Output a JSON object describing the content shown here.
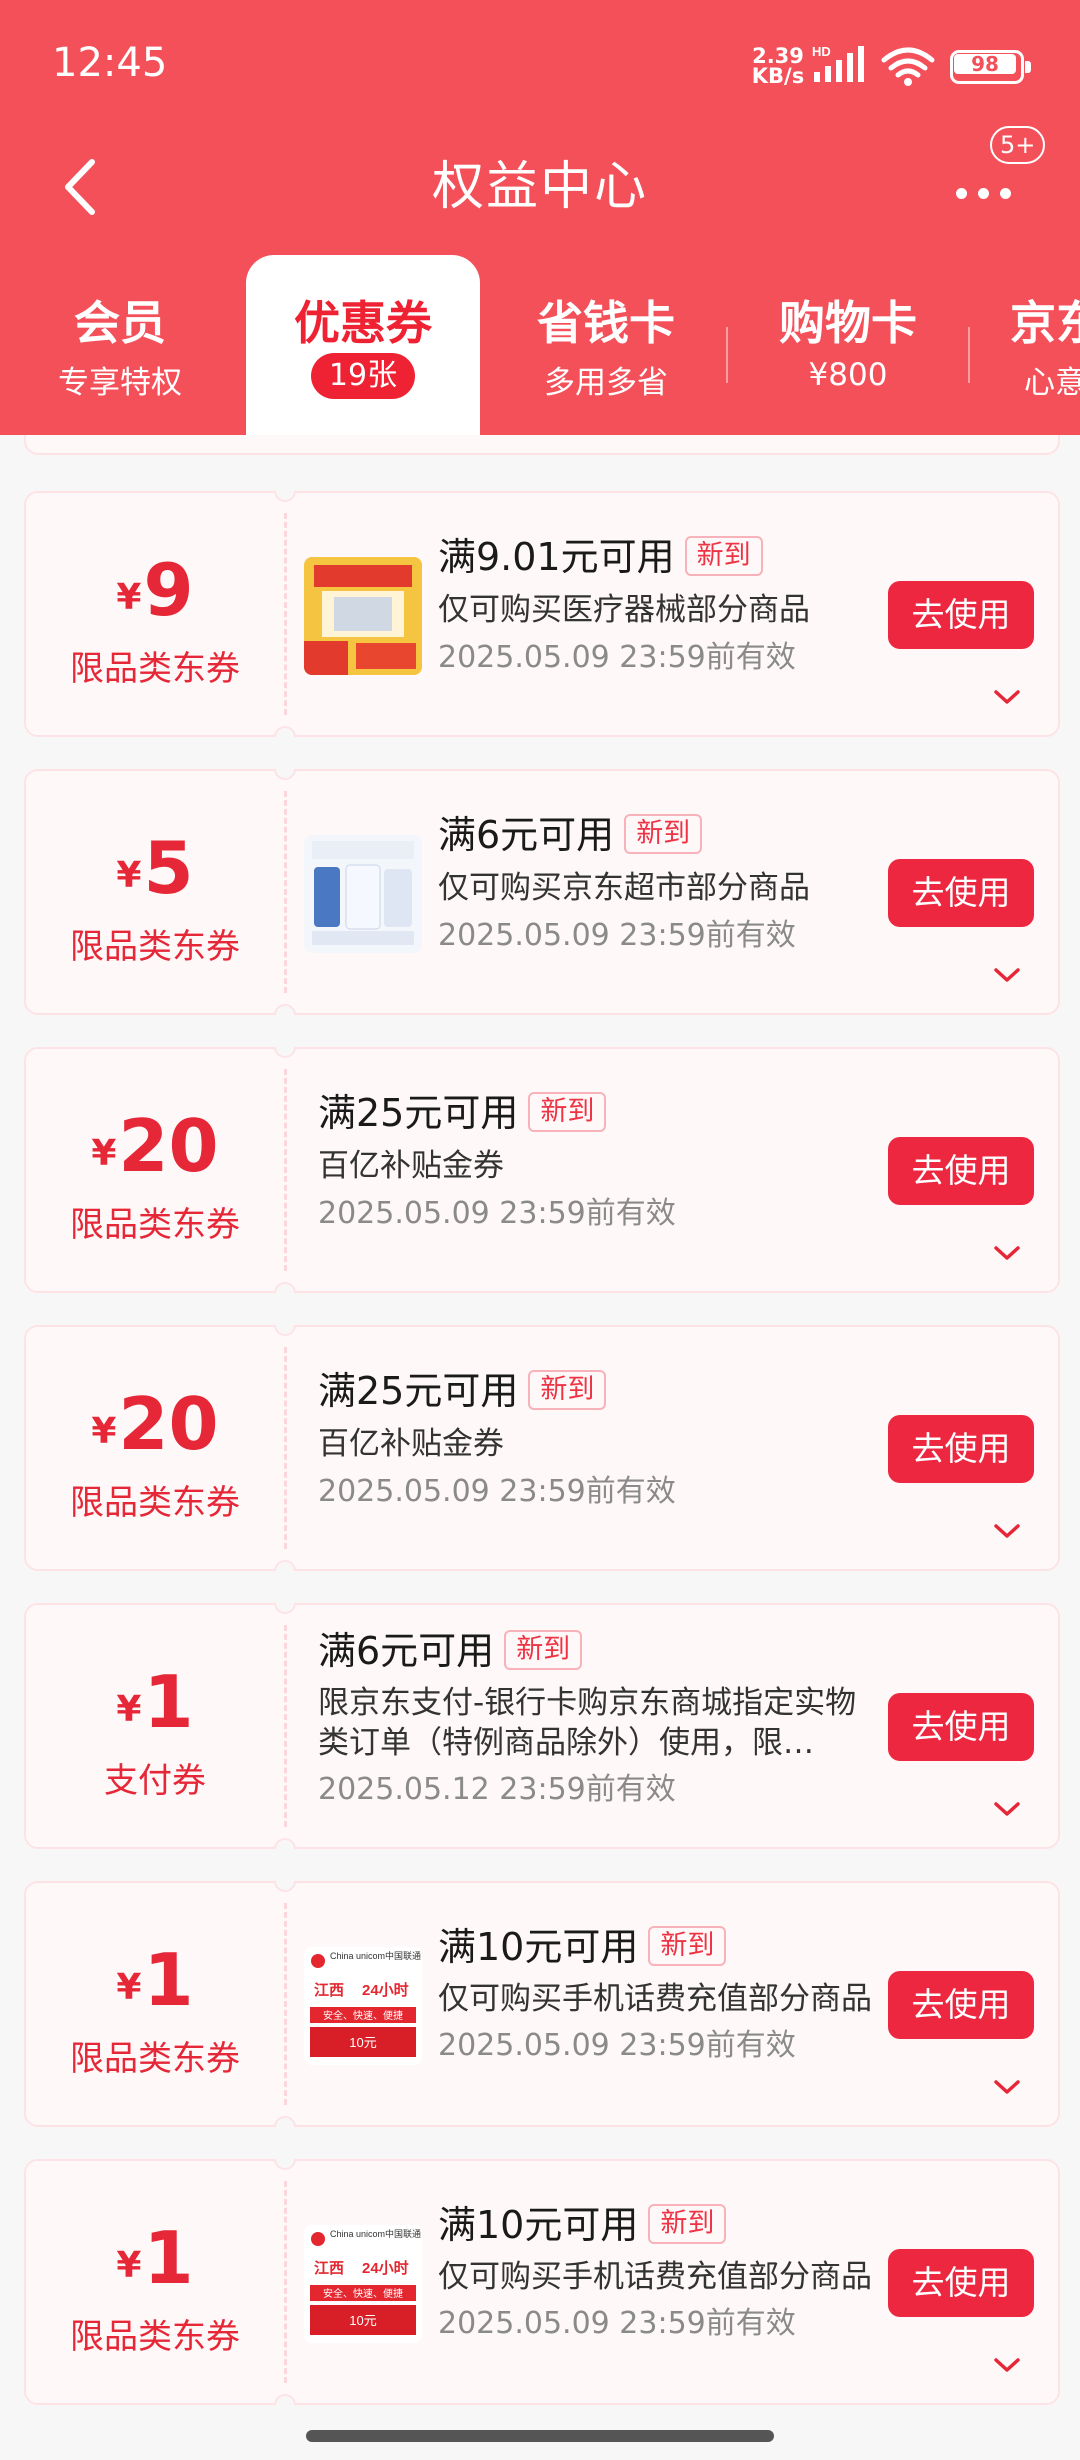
{
  "status_bar": {
    "time": "12:45",
    "net_speed_value": "2.39",
    "net_speed_unit": "KB/s",
    "network_type": "HD",
    "battery": "98"
  },
  "nav": {
    "title": "权益中心",
    "message_badge": "5+"
  },
  "tabs": [
    {
      "title": "会员",
      "sub": "专享特权"
    },
    {
      "title": "优惠券",
      "sub": "19张"
    },
    {
      "title": "省钱卡",
      "sub": "多用多省"
    },
    {
      "title": "购物卡",
      "sub": "¥800"
    },
    {
      "title": "京东",
      "sub": "心意"
    }
  ],
  "coupons": [
    {
      "symbol": "¥",
      "amount": "9",
      "type": "限品类东券",
      "condition": "满9.01元可用",
      "tag": "新到",
      "description": "仅可购买医疗器械部分商品",
      "expiry": "2025.05.09 23:59前有效",
      "button": "去使用",
      "thumb": "medical-product-thumbnail"
    },
    {
      "symbol": "¥",
      "amount": "5",
      "type": "限品类东券",
      "condition": "满6元可用",
      "tag": "新到",
      "description": "仅可购买京东超市部分商品",
      "expiry": "2025.05.09 23:59前有效",
      "button": "去使用",
      "thumb": "milk-powder-thumbnail"
    },
    {
      "symbol": "¥",
      "amount": "20",
      "type": "限品类东券",
      "condition": "满25元可用",
      "tag": "新到",
      "description": "百亿补贴金券",
      "expiry": "2025.05.09 23:59前有效",
      "button": "去使用"
    },
    {
      "symbol": "¥",
      "amount": "20",
      "type": "限品类东券",
      "condition": "满25元可用",
      "tag": "新到",
      "description": "百亿补贴金券",
      "expiry": "2025.05.09 23:59前有效",
      "button": "去使用"
    },
    {
      "symbol": "¥",
      "amount": "1",
      "type": "支付券",
      "condition": "满6元可用",
      "tag": "新到",
      "description": "限京东支付-银行卡购京东商城指定实物类订单（特例商品除外）使用，限…",
      "expiry": "2025.05.12 23:59前有效",
      "button": "去使用"
    },
    {
      "symbol": "¥",
      "amount": "1",
      "type": "限品类东券",
      "condition": "满10元可用",
      "tag": "新到",
      "description": "仅可购买手机话费充值部分商品",
      "expiry": "2025.05.09 23:59前有效",
      "button": "去使用",
      "thumb": "china-unicom-topup-thumbnail"
    },
    {
      "symbol": "¥",
      "amount": "1",
      "type": "限品类东券",
      "condition": "满10元可用",
      "tag": "新到",
      "description": "仅可购买手机话费充值部分商品",
      "expiry": "2025.05.09 23:59前有效",
      "button": "去使用",
      "thumb": "china-unicom-topup-thumbnail"
    }
  ],
  "thumbs": {
    "unicom_brand": "China unicom中国联通",
    "unicom_region": "江西",
    "unicom_hours": "24小时",
    "unicom_slogan": "安全、快速、便捷",
    "unicom_value": "10元"
  }
}
